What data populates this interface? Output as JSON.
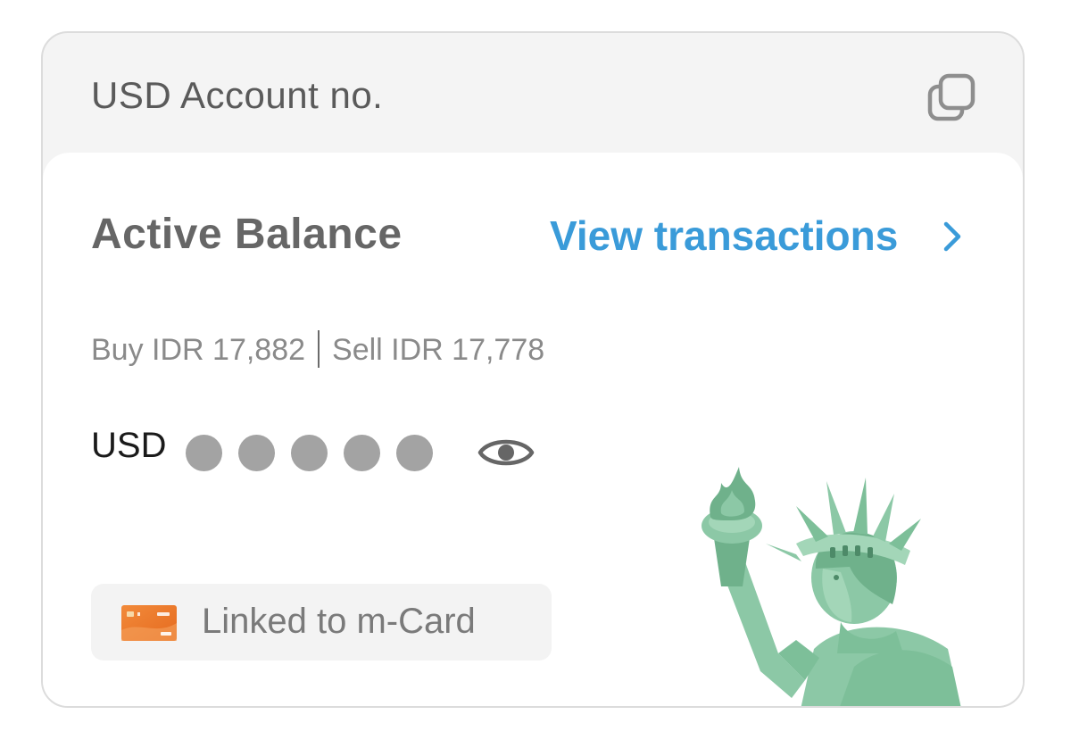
{
  "header": {
    "account_label": "USD Account no.",
    "copy_icon": "copy-icon"
  },
  "balance": {
    "title": "Active Balance",
    "view_transactions_label": "View transactions",
    "chevron_icon": "chevron-right-icon",
    "rates": {
      "buy": "Buy IDR 17,882",
      "sell": "Sell IDR 17,778"
    },
    "currency": "USD",
    "masked_dots": 5,
    "eye_icon": "eye-icon"
  },
  "linked": {
    "label": "Linked to m-Card",
    "card_icon": "mcard-icon"
  },
  "illustration": "statue-of-liberty-illustration",
  "colors": {
    "accent": "#3a9bd9",
    "header_bg": "#f4f4f4",
    "statue_green": "#8cc8a6",
    "card_orange": "#ef7d2d"
  }
}
